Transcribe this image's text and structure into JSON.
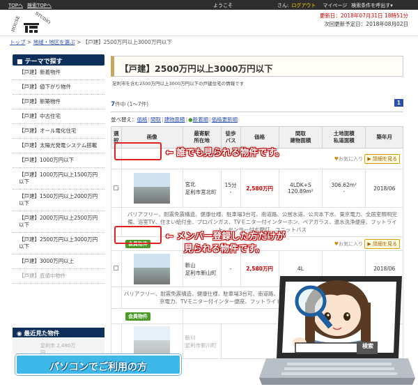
{
  "topbar": {
    "link1": "TOPへ",
    "link2": "検索TOPへ",
    "welcome": "ようこそ",
    "user_suffix": "さん:",
    "logout": "ログアウト",
    "mypage": "マイページ",
    "search_cond": "検索条件を呼出す▾"
  },
  "header": {
    "updated": "更新日：2018年07月31日 18時51分",
    "next_update": "次回更新予定日：2018年08月02日",
    "logo_text": "HOUSE STUDIO"
  },
  "breadcrumb": {
    "home": "トップ",
    "sep": ">",
    "area": "地域・地区を選ぶ",
    "current": "【戸建】2500万円以上3000万円以下"
  },
  "sidebar": {
    "heading": "テーマで探す",
    "items": [
      "【戸建】新着物件",
      "【戸建】値下がり物件",
      "【戸建】新築物件",
      "【戸建】中古住宅",
      "【戸建】オール電化住宅",
      "【戸建】太陽光発電システム搭載",
      "【戸建】1000万円以下",
      "【戸建】1000万円以上1500万円以下",
      "【戸建】1500万円以上2000万円以下",
      "【戸建】2000万円以上2500万円以下",
      "【戸建】2500万円以上3000万円以下",
      "【戸建】3000万円以上",
      "【戸建】底値中物件"
    ],
    "recent_heading": "最近見た物件",
    "recent_partial": "足利市 2,480万円"
  },
  "main": {
    "title": "【戸建】2500万円以上3000万円以下",
    "desc": "足利市を含む2500万円以上3000万円以下の戸建住宅の情報です",
    "count_num": "7",
    "count_text": "件中 (1〜7件)",
    "page": "1",
    "sort_label": "並べ替え：",
    "sort": [
      "価格",
      "間取",
      "建物面積",
      "新着順",
      "価格更新順"
    ]
  },
  "table": {
    "headers": [
      "選択",
      "画像",
      "最寄駅\n所在地",
      "徒歩\nバス",
      "価格",
      "間取\n建物面積",
      "土地面積\n私道面積",
      "築年月"
    ],
    "fav_label": "お気に入り",
    "detail_label": "詳細を見る",
    "member_badge": "会員物件",
    "rows": [
      {
        "station": "宮北",
        "address": "足利市宮北町",
        "walk": "15分",
        "walk2": "-",
        "price": "2,580万円",
        "layout": "4LDK+S",
        "area": "120.89m²",
        "land": "306.62m²",
        "land2": "-",
        "built": "2018/06"
      },
      {
        "station": "新山",
        "address": "足利市新山町",
        "walk": "-",
        "walk2": "",
        "price": "2,580万円",
        "layout": "4L",
        "area": "",
        "land": "",
        "land2": "",
        "built": "2018/06"
      }
    ],
    "feat1": "バリアフリー、耐震免震構造、健康仕様、駐車場3台可、南道路、公営水道、公共本下水、東京電力、全居室照明完備、浴室TV、住まい給付金、プロパンガス、TVモニター付インターホン、ペアガラス、温水洗浄便座、フットライト、センサー付玄関灯、ユニットバス",
    "feat2": "バリアフリー、耐震免震構造、健康仕様、駐車場3台可、南道路、公営水道、い給付金、浴室TV、全居室照明完備、東京電力、TVモニター付インター便座、フットライト、センサー付玄関灯、ユニットバス",
    "row3_station": "新川",
    "row3_address": "足利市新川町"
  },
  "callouts": {
    "c1": "← 誰でも見られる物件です。",
    "c2a": "← メンバー登録した方だけが",
    "c2b": "見られる物件です。"
  },
  "laptop": {
    "search_btn": "検索"
  },
  "badge": {
    "pc": "パソコンでご利用の方"
  }
}
